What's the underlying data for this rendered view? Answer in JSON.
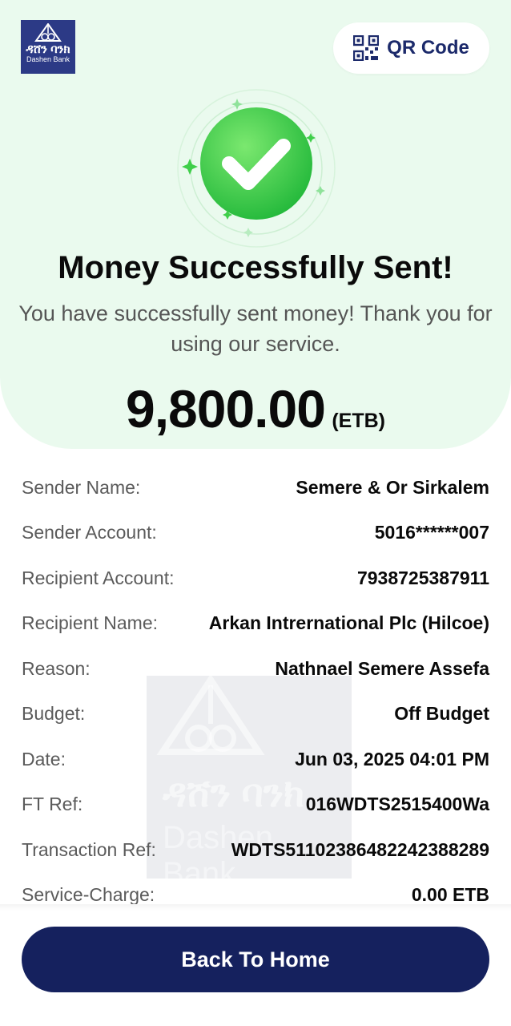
{
  "brand": {
    "logo_text_ethiopic": "ዳሸን ባንክ",
    "logo_text_latin": "Dashen Bank",
    "brand_color": "#2c3a86"
  },
  "header": {
    "qr_button_label": "QR Code"
  },
  "status": {
    "title": "Money Successfully Sent!",
    "message": "You have successfully sent money! Thank you for using our service.",
    "icon": "check-circle-icon",
    "accent_color": "#3fcf4a"
  },
  "amount": {
    "value": "9,800.00",
    "currency": "(ETB)"
  },
  "details": [
    {
      "label": "Sender Name:",
      "value": "Semere & Or Sirkalem"
    },
    {
      "label": "Sender Account:",
      "value": "5016******007"
    },
    {
      "label": "Recipient Account:",
      "value": "7938725387911"
    },
    {
      "label": "Recipient Name:",
      "value": "Arkan Intrernational Plc (Hilcoe)"
    },
    {
      "label": "Reason:",
      "value": "Nathnael Semere Assefa"
    },
    {
      "label": "Budget:",
      "value": "Off Budget"
    },
    {
      "label": "Date:",
      "value": "Jun 03, 2025 04:01 PM"
    },
    {
      "label": "FT Ref:",
      "value": "016WDTS2515400Wa"
    },
    {
      "label": "Transaction Ref:",
      "value": "WDTS51102386482242388289"
    },
    {
      "label": "Service-Charge:",
      "value": "0.00 ETB"
    }
  ],
  "footer": {
    "home_button_label": "Back To Home",
    "button_color": "#15215e"
  }
}
